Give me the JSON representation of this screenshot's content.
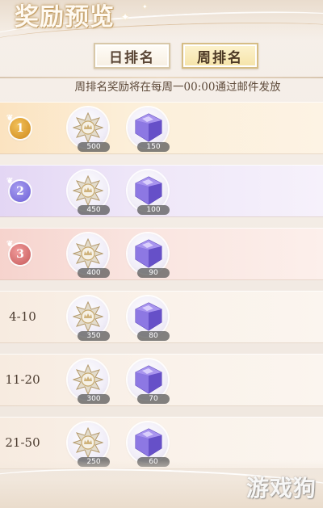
{
  "header": {
    "title": "奖励预览"
  },
  "tabs": [
    {
      "label": "日排名",
      "active": false
    },
    {
      "label": "周排名",
      "active": true
    }
  ],
  "notice": "周排名奖励将在每周一00:00通过邮件发放",
  "rewards": [
    {
      "rank": "1",
      "badge": "gold",
      "medal_count": "500",
      "gem_count": "150"
    },
    {
      "rank": "2",
      "badge": "purple",
      "medal_count": "450",
      "gem_count": "100"
    },
    {
      "rank": "3",
      "badge": "red",
      "medal_count": "400",
      "gem_count": "90"
    },
    {
      "rank": "4-10",
      "badge": "none",
      "medal_count": "350",
      "gem_count": "80"
    },
    {
      "rank": "11-20",
      "badge": "none",
      "medal_count": "300",
      "gem_count": "70"
    },
    {
      "rank": "21-50",
      "badge": "none",
      "medal_count": "250",
      "gem_count": "60"
    }
  ],
  "icons": {
    "medal": "silver-crown-medal-icon",
    "gem": "purple-diamond-icon"
  },
  "colors": {
    "gold_row": "#fbe3c0",
    "purple_row": "#e3d6f4",
    "red_row": "#f6d3cd",
    "gem_purple": "#7a62d8",
    "active_tab": "#f5e3a8"
  },
  "watermark": "游戏狗"
}
